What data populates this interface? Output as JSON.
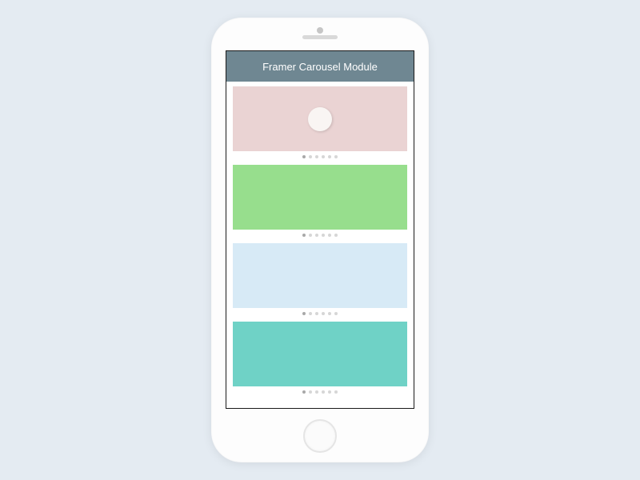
{
  "header": {
    "title": "Framer Carousel Module",
    "background": "#6f8792"
  },
  "carousels": [
    {
      "color": "#ead3d3",
      "dot_count": 6,
      "active_dot": 0,
      "has_circle": true
    },
    {
      "color": "#97de8d",
      "dot_count": 6,
      "active_dot": 0,
      "has_circle": false
    },
    {
      "color": "#d7eaf6",
      "dot_count": 6,
      "active_dot": 0,
      "has_circle": false
    },
    {
      "color": "#6fd2c6",
      "dot_count": 6,
      "active_dot": 0,
      "has_circle": false
    }
  ]
}
